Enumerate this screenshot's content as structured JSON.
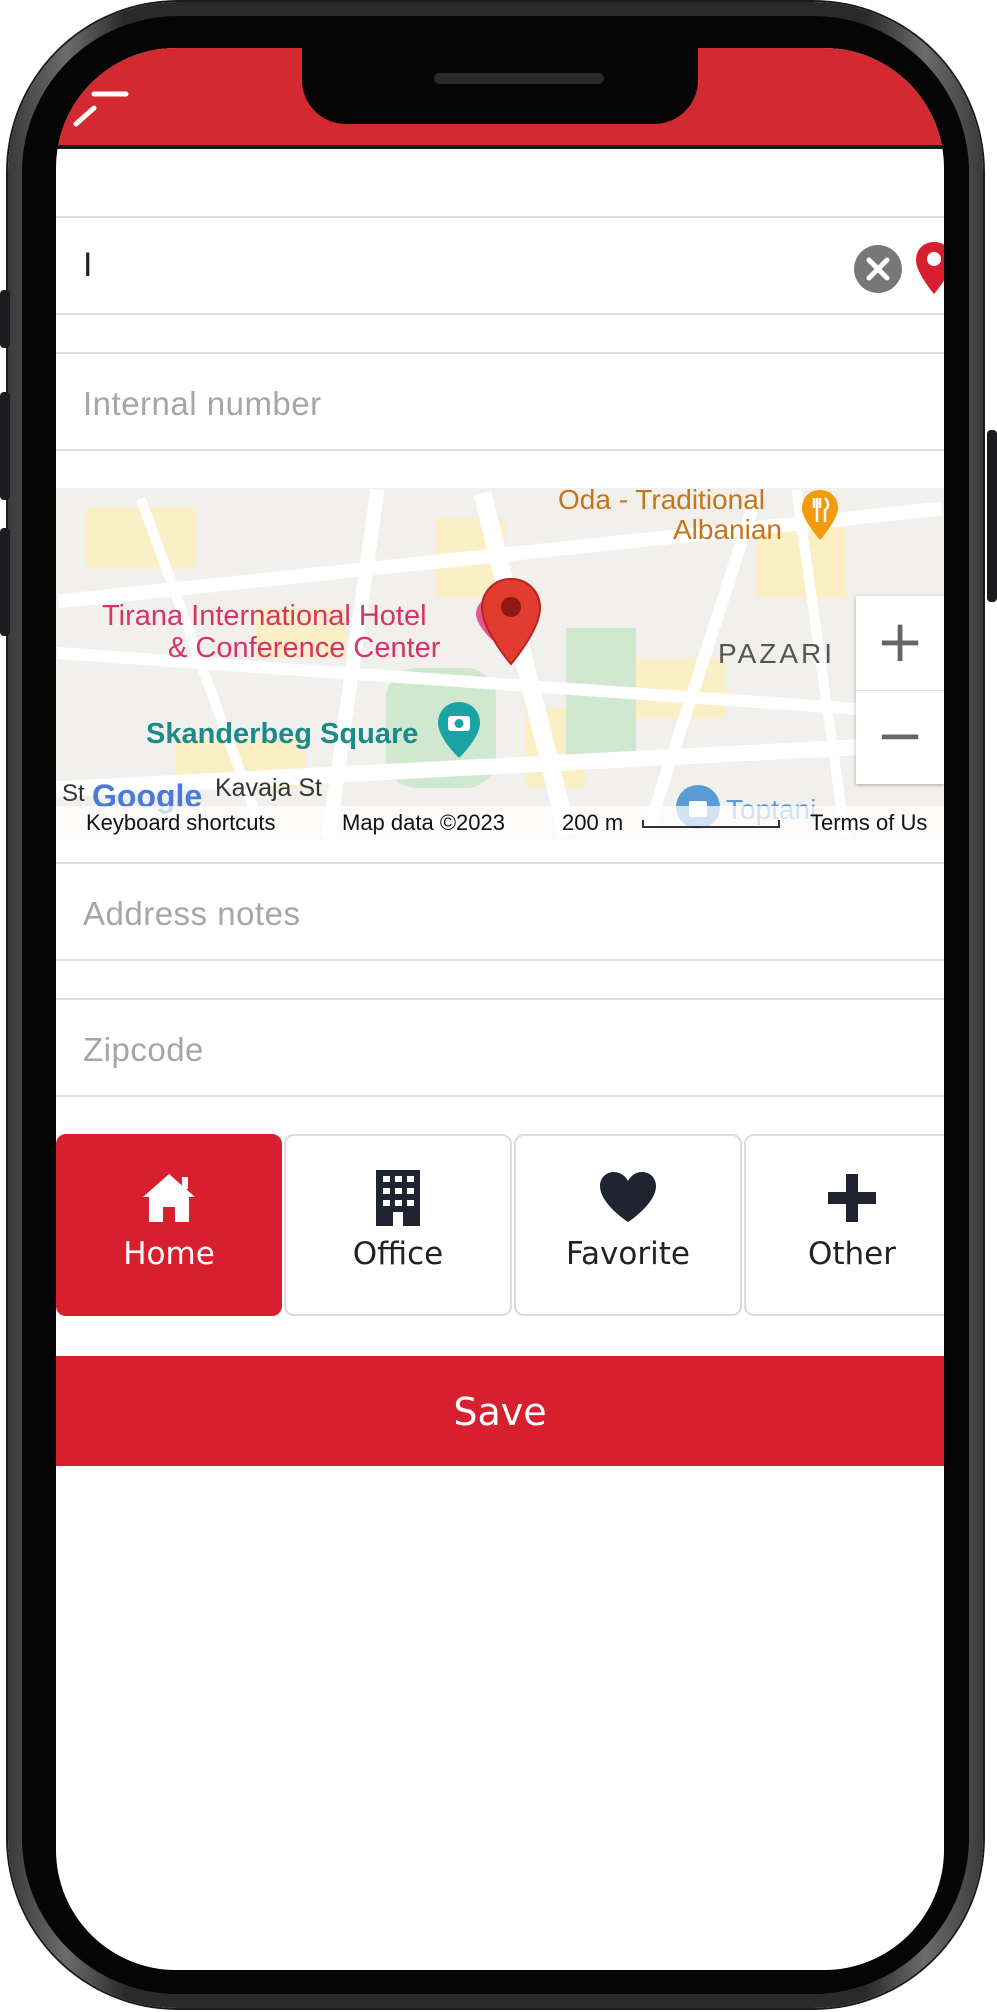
{
  "address": {
    "value": "I"
  },
  "internal_number": {
    "placeholder": "Internal number"
  },
  "map": {
    "labels": {
      "restaurant_line1": "Oda - Traditional",
      "restaurant_line2": "Albanian",
      "hotel_line1": "Tirana International Hotel",
      "hotel_line2": "& Conference Center",
      "square": "Skanderbeg Square",
      "district": "PAZARI",
      "street": "Kavaja St",
      "street_partial": "a St",
      "partial_poi": "Toptani"
    },
    "zoom_in": "+",
    "zoom_out": "−",
    "footer": {
      "keyboard": "Keyboard shortcuts",
      "data": "Map data ©2023",
      "scale": "200 m",
      "terms": "Terms of Us"
    },
    "logo": "Google"
  },
  "address_notes": {
    "placeholder": "Address notes"
  },
  "zipcode": {
    "placeholder": "Zipcode"
  },
  "address_types": [
    {
      "label": "Home",
      "icon": "home-icon",
      "active": true
    },
    {
      "label": "Office",
      "icon": "office-building-icon",
      "active": false
    },
    {
      "label": "Favorite",
      "icon": "heart-icon",
      "active": false
    },
    {
      "label": "Other",
      "icon": "plus-icon",
      "active": false
    }
  ],
  "save_label": "Save",
  "colors": {
    "brand_red": "#d81f2f",
    "header_red": "#d32a31",
    "icon_dark": "#1f2430"
  }
}
